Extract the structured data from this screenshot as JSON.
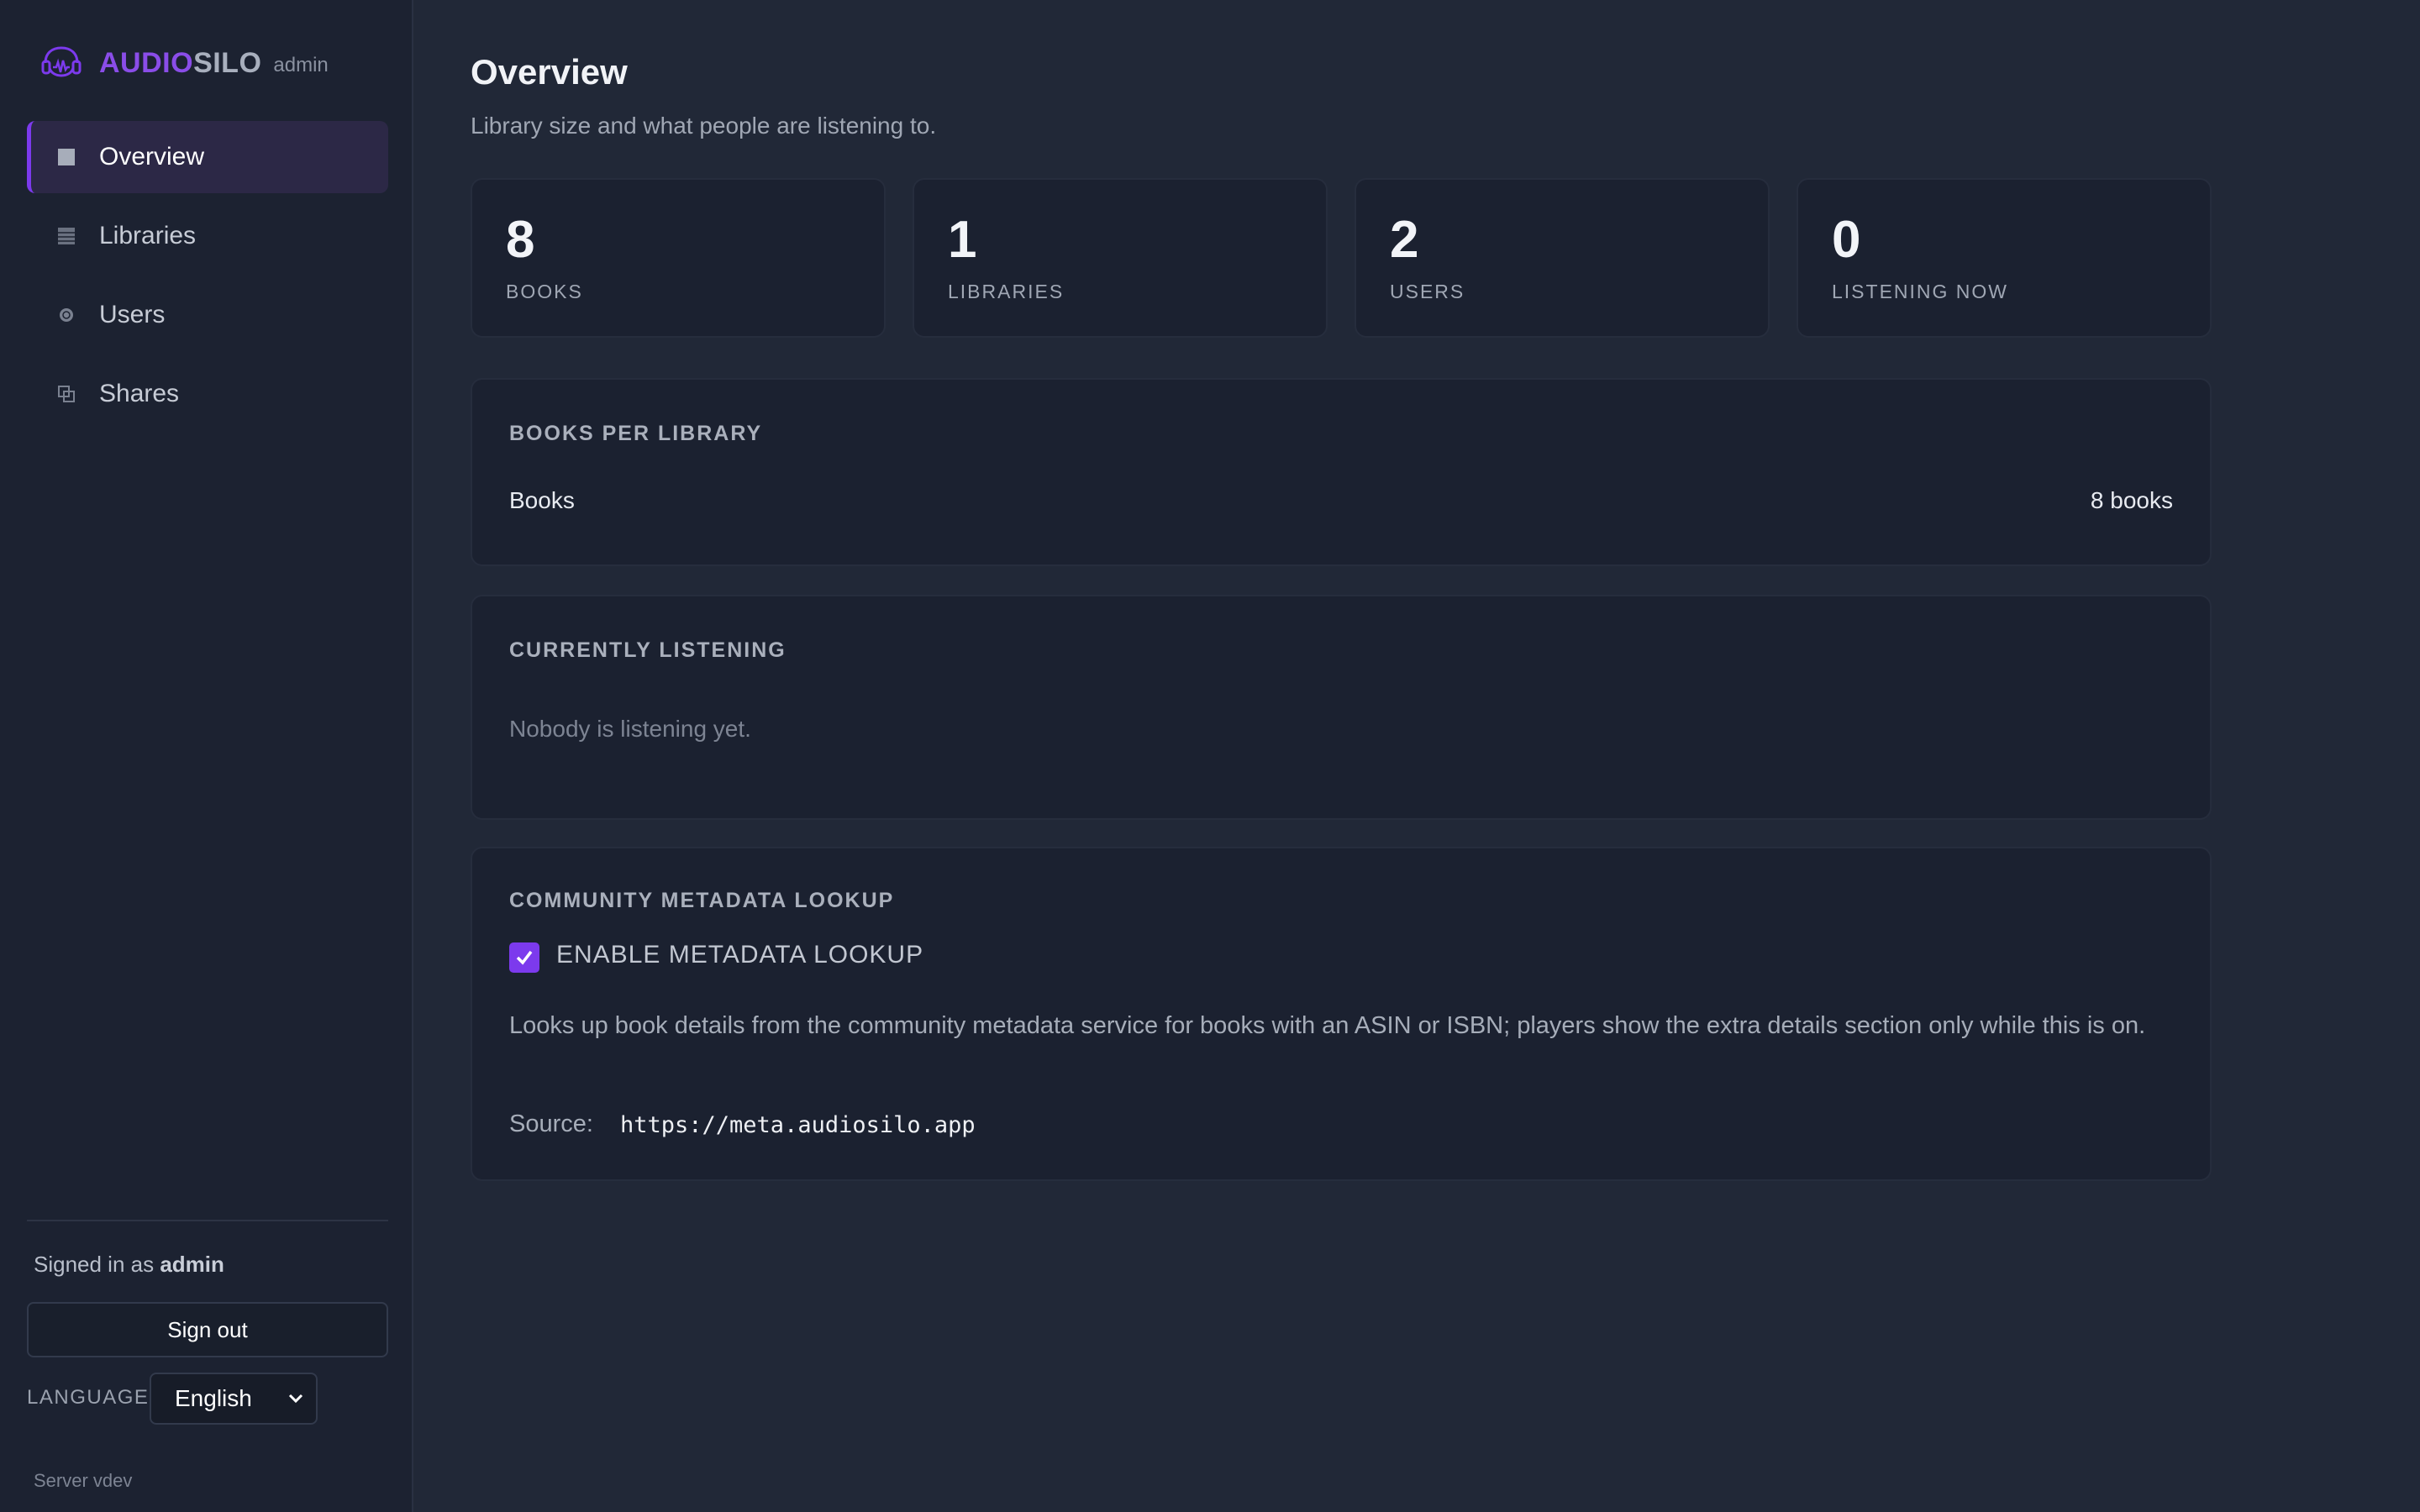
{
  "brand": {
    "name_part1": "AUDIO",
    "name_part2": "SILO",
    "role": "admin"
  },
  "sidebar": {
    "items": [
      {
        "label": "Overview",
        "icon": "square-icon",
        "active": true
      },
      {
        "label": "Libraries",
        "icon": "library-icon",
        "active": false
      },
      {
        "label": "Users",
        "icon": "user-dot-icon",
        "active": false
      },
      {
        "label": "Shares",
        "icon": "share-icon",
        "active": false
      }
    ]
  },
  "footer": {
    "signed_in_prefix": "Signed in as",
    "username": "admin",
    "sign_out_label": "Sign out",
    "language_label": "LANGUAGE",
    "language_value": "English",
    "server_version": "Server vdev"
  },
  "page": {
    "title": "Overview",
    "subtitle": "Library size and what people are listening to."
  },
  "stats": [
    {
      "value": "8",
      "label": "BOOKS"
    },
    {
      "value": "1",
      "label": "LIBRARIES"
    },
    {
      "value": "2",
      "label": "USERS"
    },
    {
      "value": "0",
      "label": "LISTENING NOW"
    }
  ],
  "books_per_library": {
    "heading": "BOOKS PER LIBRARY",
    "rows": [
      {
        "name": "Books",
        "count": "8 books"
      }
    ]
  },
  "currently_listening": {
    "heading": "CURRENTLY LISTENING",
    "empty_text": "Nobody is listening yet."
  },
  "metadata_lookup": {
    "heading": "COMMUNITY METADATA LOOKUP",
    "checkbox_label": "ENABLE METADATA LOOKUP",
    "checked": true,
    "description": "Looks up book details from the community metadata service for books with an ASIN or ISBN; players show the extra details section only while this is on.",
    "source_label": "Source:",
    "source_url": "https://meta.audiosilo.app"
  },
  "colors": {
    "accent": "#7c3aed",
    "background": "#212837",
    "sidebar": "#1c2231",
    "card": "#1b2130"
  }
}
